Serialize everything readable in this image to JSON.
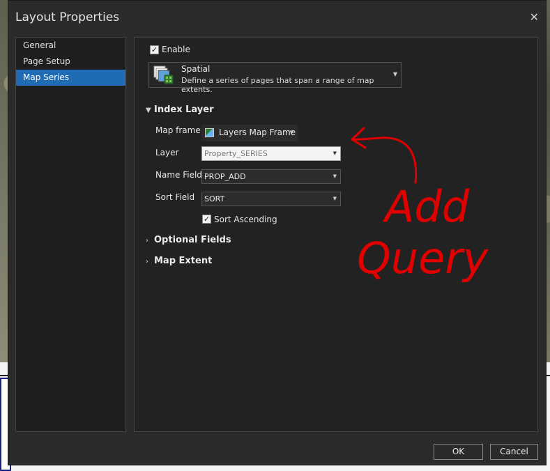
{
  "dialog": {
    "title": "Layout Properties",
    "close_glyph": "✕"
  },
  "nav": {
    "items": [
      {
        "label": "General"
      },
      {
        "label": "Page Setup"
      },
      {
        "label": "Map Series"
      }
    ],
    "selected": "Map Series"
  },
  "enable": {
    "label": "Enable",
    "checked": true
  },
  "series_type": {
    "name": "Spatial",
    "description": "Define a series of pages that span a range of map extents.",
    "icon": "spatial-series-icon"
  },
  "index_layer": {
    "heading": "Index Layer",
    "map_frame_label": "Map frame",
    "map_frame_value": "Layers Map Frame",
    "layer_label": "Layer",
    "layer_value": "Property_SERIES",
    "name_field_label": "Name Field",
    "name_field_value": "PROP_ADD",
    "sort_field_label": "Sort Field",
    "sort_field_value": "SORT",
    "sort_ascending_label": "Sort Ascending",
    "sort_ascending_checked": true
  },
  "optional_fields": {
    "heading": "Optional Fields"
  },
  "map_extent": {
    "heading": "Map Extent"
  },
  "buttons": {
    "ok": "OK",
    "cancel": "Cancel"
  },
  "annotation": {
    "line1": "Add",
    "line2": "Query",
    "color": "#e00000"
  },
  "colors": {
    "accent": "#1f6bb4",
    "dialog_bg": "#2b2b2b",
    "panel_bg": "#222222"
  }
}
